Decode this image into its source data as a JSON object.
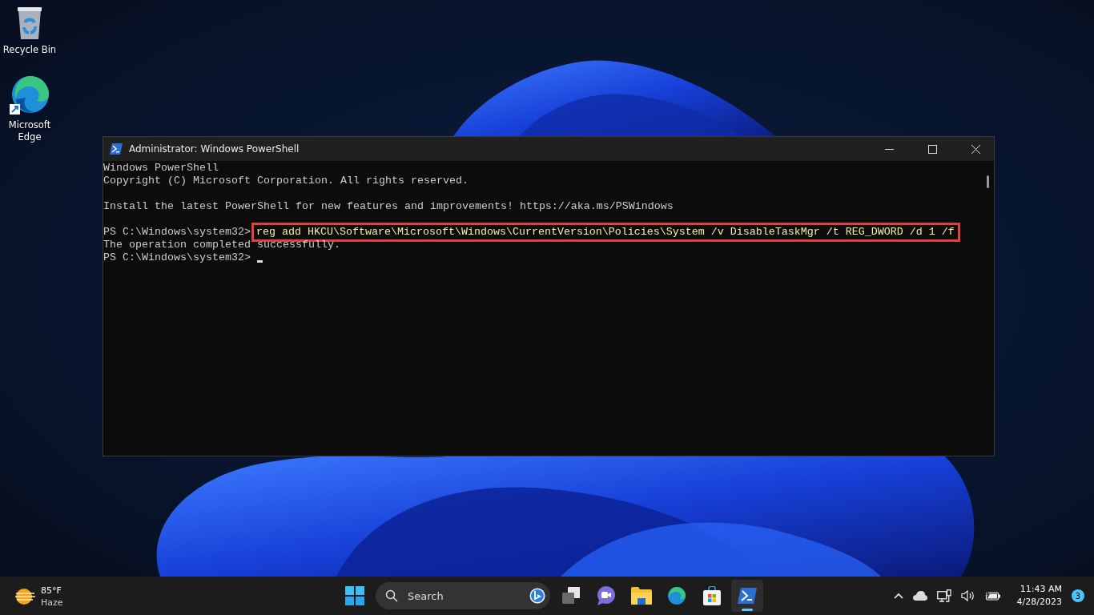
{
  "desktop_icons": [
    {
      "kind": "recycle_bin",
      "label": "Recycle Bin"
    },
    {
      "kind": "edge",
      "label": "Microsoft Edge"
    }
  ],
  "window": {
    "title": "Administrator: Windows PowerShell",
    "lines": [
      {
        "kind": "text",
        "text": "Windows PowerShell"
      },
      {
        "kind": "text",
        "text": "Copyright (C) Microsoft Corporation. All rights reserved."
      },
      {
        "kind": "blank"
      },
      {
        "kind": "text",
        "text": "Install the latest PowerShell for new features and improvements! https://aka.ms/PSWindows"
      },
      {
        "kind": "blank"
      },
      {
        "kind": "command",
        "prompt": "PS C:\\Windows\\system32>",
        "command": "reg add HKCU\\Software\\Microsoft\\Windows\\CurrentVersion\\Policies\\System /v DisableTaskMgr /t REG_DWORD /d 1 /f",
        "highlighted": true
      },
      {
        "kind": "text",
        "text": "The operation completed successfully."
      },
      {
        "kind": "cursor",
        "prompt": "PS C:\\Windows\\system32>"
      }
    ]
  },
  "taskbar": {
    "weather": {
      "temperature": "85°F",
      "condition": "Haze"
    },
    "search": {
      "placeholder": "Search"
    },
    "apps": [
      {
        "kind": "task_view",
        "selected": false
      },
      {
        "kind": "chat",
        "selected": false
      },
      {
        "kind": "files",
        "selected": false
      },
      {
        "kind": "edge",
        "selected": false
      },
      {
        "kind": "store",
        "selected": false
      },
      {
        "kind": "powershell",
        "selected": true
      }
    ],
    "time": "11:43 AM",
    "date": "4/28/2023",
    "notifications": "3"
  }
}
